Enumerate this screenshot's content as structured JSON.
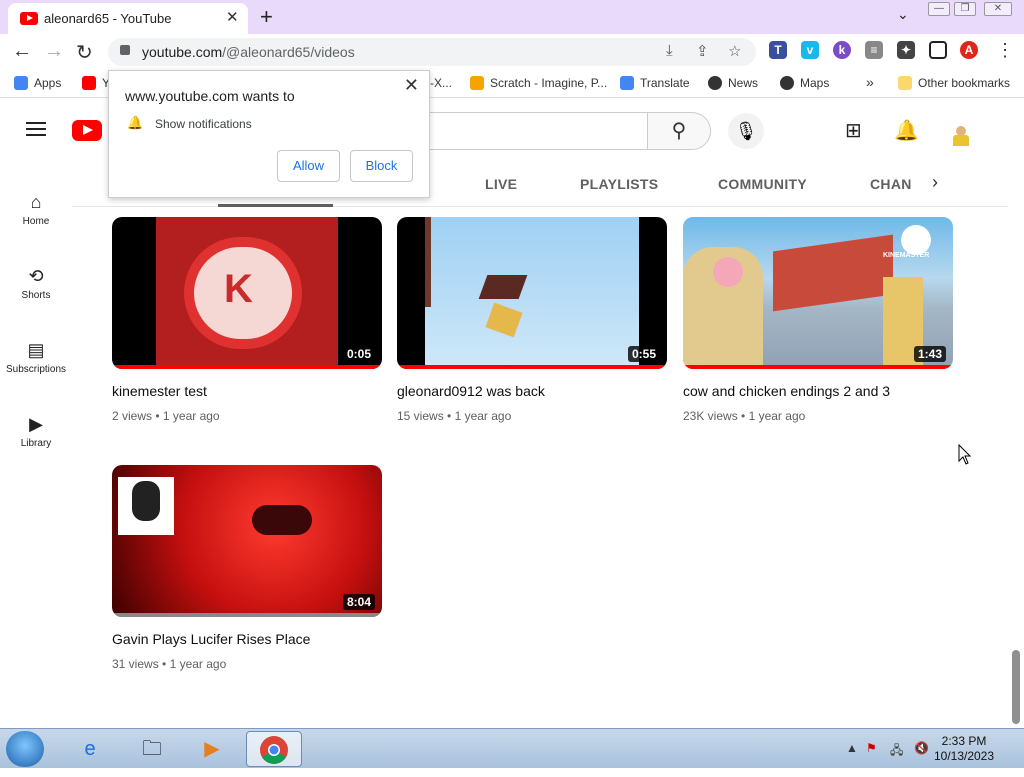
{
  "browser": {
    "tab_title": "aleonard65 - YouTube",
    "tab_close": "✕",
    "new_tab": "+",
    "tab_list": "⌄",
    "url_host": "youtube.com",
    "url_path": "/@aleonard65/videos",
    "bookmarks": [
      {
        "label": "Apps",
        "icon_color": "#4285f4"
      },
      {
        "label": "Y",
        "icon_color": "#ff0000"
      },
      {
        "label": "-X...",
        "icon_color": "#888888"
      },
      {
        "label": "Scratch - Imagine, P...",
        "icon_color": "#f7a400"
      },
      {
        "label": "Translate",
        "icon_color": "#4285f4"
      },
      {
        "label": "News",
        "icon_color": "#333333"
      },
      {
        "label": "Maps",
        "icon_color": "#333333"
      },
      {
        "label": "»",
        "icon_color": ""
      },
      {
        "label": "Other bookmarks",
        "icon_color": "#f9d96c"
      }
    ]
  },
  "popup": {
    "title": "www.youtube.com wants to",
    "permission": "Show notifications",
    "allow_label": "Allow",
    "block_label": "Block",
    "close": "✕"
  },
  "sidebar": {
    "items": [
      {
        "label": "Home",
        "icon": "home-icon"
      },
      {
        "label": "Shorts",
        "icon": "shorts-icon"
      },
      {
        "label": "Subscriptions",
        "icon": "subscriptions-icon"
      },
      {
        "label": "Library",
        "icon": "library-icon"
      }
    ]
  },
  "channel_tabs": [
    "LIVE",
    "PLAYLISTS",
    "COMMUNITY",
    "CHAN"
  ],
  "videos": [
    {
      "title": "kinemester test",
      "views": "2 views",
      "age": "1 year ago",
      "duration": "0:05"
    },
    {
      "title": "gleonard0912 was back",
      "views": "15 views",
      "age": "1 year ago",
      "duration": "0:55"
    },
    {
      "title": "cow and chicken endings 2 and 3",
      "views": "23K views",
      "age": "1 year ago",
      "duration": "1:43"
    },
    {
      "title": "Gavin Plays Lucifer Rises Place",
      "views": "31 views",
      "age": "1 year ago",
      "duration": "8:04"
    }
  ],
  "thumbnail_text": {
    "kinemaster_badge": "KINEMASTER",
    "k_letter": "K"
  },
  "taskbar": {
    "time": "2:33 PM",
    "date": "10/13/2023"
  },
  "colors": {
    "tab_strip": "#e9d9fb",
    "youtube_red": "#ff0000",
    "link_blue": "#1a73e8"
  }
}
